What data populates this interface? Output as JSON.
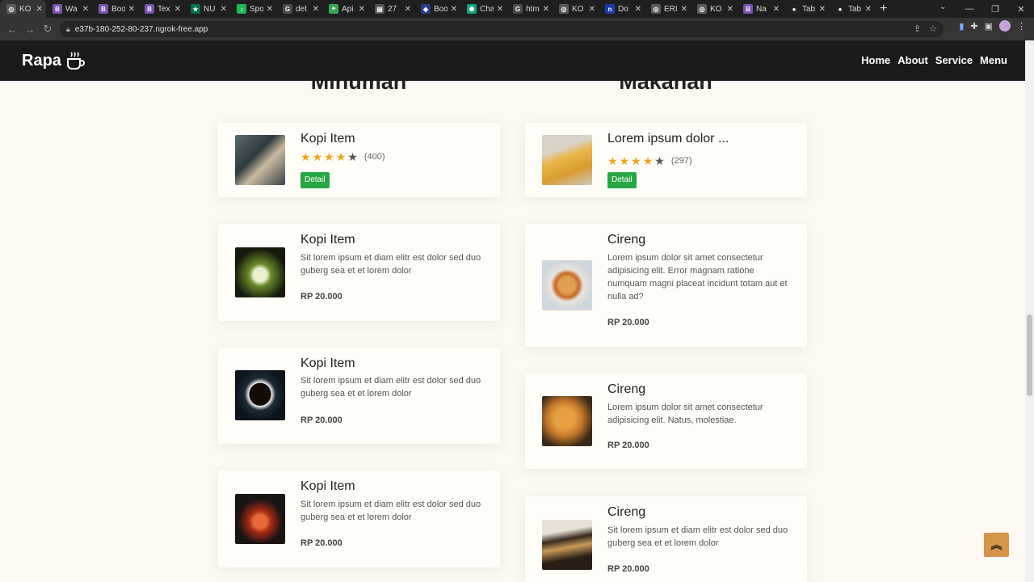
{
  "browser": {
    "tabs": [
      {
        "title": "KO",
        "fav": "globe-icon",
        "favcolor": "#5a5a5a",
        "active": true
      },
      {
        "title": "Wa",
        "fav": "bootstrap-icon",
        "favcolor": "#7952b3"
      },
      {
        "title": "Boo",
        "fav": "bootstrap-icon",
        "favcolor": "#7952b3"
      },
      {
        "title": "Tex",
        "fav": "bootstrap-icon",
        "favcolor": "#7952b3"
      },
      {
        "title": "NU",
        "fav": "starbucks-icon",
        "favcolor": "#00704a"
      },
      {
        "title": "Spo",
        "fav": "spotify-icon",
        "favcolor": "#1db954"
      },
      {
        "title": "det",
        "fav": "google-icon",
        "favcolor": "#4a4a4a"
      },
      {
        "title": "Api",
        "fav": "maps-icon",
        "favcolor": "#34a853"
      },
      {
        "title": "27",
        "fav": "doc-icon",
        "favcolor": "#555555"
      },
      {
        "title": "Boo",
        "fav": "bookmark-icon",
        "favcolor": "#2d3e8a"
      },
      {
        "title": "Cha",
        "fav": "openai-icon",
        "favcolor": "#10a37f"
      },
      {
        "title": "htm",
        "fav": "google-icon",
        "favcolor": "#4a4a4a"
      },
      {
        "title": "KO",
        "fav": "globe-icon",
        "favcolor": "#5a5a5a"
      },
      {
        "title": "Do",
        "fav": "n-icon",
        "favcolor": "#1a3cb5"
      },
      {
        "title": "ERI",
        "fav": "globe-icon",
        "favcolor": "#5a5a5a"
      },
      {
        "title": "KO",
        "fav": "globe-icon",
        "favcolor": "#5a5a5a"
      },
      {
        "title": "Na",
        "fav": "bootstrap-icon",
        "favcolor": "#7952b3"
      },
      {
        "title": "Tab",
        "fav": "github-icon",
        "favcolor": "#222222"
      },
      {
        "title": "Tab",
        "fav": "github-icon",
        "favcolor": "#222222"
      }
    ],
    "url": "e37b-180-252-80-237.ngrok-free.app"
  },
  "site": {
    "brand": "Rapa",
    "menu": [
      "Home",
      "About",
      "Service",
      "Menu"
    ]
  },
  "sections": {
    "minuman": {
      "title": "Minuman",
      "featured": {
        "title": "Kopi Item",
        "rating": 4,
        "count": "(400)",
        "button": "Detail"
      },
      "items": [
        {
          "title": "Kopi Item",
          "desc": "Sit lorem ipsum et diam elitr est dolor sed duo guberg sea et et lorem dolor",
          "price": "RP 20.000"
        },
        {
          "title": "Kopi Item",
          "desc": "Sit lorem ipsum et diam elitr est dolor sed duo guberg sea et et lorem dolor",
          "price": "RP 20.000"
        },
        {
          "title": "Kopi Item",
          "desc": "Sit lorem ipsum et diam elitr est dolor sed duo guberg sea et et lorem dolor",
          "price": "RP 20.000"
        }
      ]
    },
    "makanan": {
      "title": "Makanan",
      "featured": {
        "title": "Lorem ipsum dolor ...",
        "rating": 4,
        "count": "(297)",
        "button": "Detail"
      },
      "items": [
        {
          "title": "Cireng",
          "desc": "Lorem ipsum dolor sit amet consectetur adipisicing elit. Error magnam ratione numquam magni placeat incidunt totam aut et nulla ad?",
          "price": "RP 20.000"
        },
        {
          "title": "Cireng",
          "desc": "Lorem ipsum dolor sit amet consectetur adipisicing elit. Natus, molestiae.",
          "price": "RP 20.000"
        },
        {
          "title": "Cireng",
          "desc": "Sit lorem ipsum et diam elitr est dolor sed duo guberg sea et et lorem dolor",
          "price": "RP 20.000"
        }
      ]
    }
  },
  "colors": {
    "nav_bg": "#1a1a1a",
    "page_bg": "#fdf9f2",
    "detail_btn": "#27a845",
    "totop": "#d69449",
    "star": "#f0a517"
  }
}
